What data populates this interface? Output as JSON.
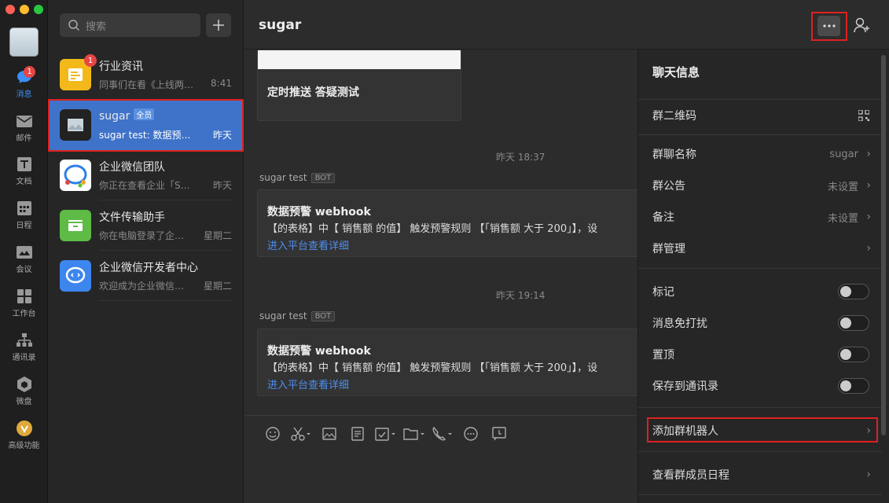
{
  "search": {
    "placeholder": "搜索"
  },
  "rail": {
    "badge": "1",
    "items": [
      "消息",
      "邮件",
      "文档",
      "日程",
      "会议",
      "工作台",
      "通讯录",
      "微盘",
      "高级功能"
    ]
  },
  "conversations": [
    {
      "name": "行业资讯",
      "preview": "同事们在看《上线两…",
      "time": "8:41",
      "badge": "1"
    },
    {
      "name": "sugar",
      "tag": "全员",
      "preview": "sugar test: 数据预警…",
      "time": "昨天"
    },
    {
      "name": "企业微信团队",
      "preview": "你正在查看企业「Su…",
      "time": "昨天"
    },
    {
      "name": "文件传输助手",
      "preview": "你在电脑登录了企…",
      "time": "星期二"
    },
    {
      "name": "企业微信开发者中心",
      "preview": "欢迎成为企业微信…",
      "time": "星期二"
    }
  ],
  "chat": {
    "title": "sugar",
    "first_card_title": "定时推送 答疑测试",
    "messages": [
      {
        "timestamp": "昨天 18:37",
        "sender": "sugar test",
        "bot_tag": "BOT",
        "title": "数据预警 webhook",
        "body": "【的表格】中【 销售额 的值】 触发预警规则 【「销售额 大于 200」】，设",
        "link": "进入平台查看详细"
      },
      {
        "timestamp": "昨天 19:14",
        "sender": "sugar test",
        "bot_tag": "BOT",
        "title": "数据预警 webhook",
        "body": "【的表格】中【 销售额 的值】 触发预警规则 【「销售额 大于 200」】，设",
        "link": "进入平台查看详细"
      }
    ]
  },
  "panel": {
    "title": "聊天信息",
    "qr": "群二维码",
    "group_name": {
      "label": "群聊名称",
      "value": "sugar"
    },
    "announcement": {
      "label": "群公告",
      "value": "未设置"
    },
    "remark": {
      "label": "备注",
      "value": "未设置"
    },
    "manage": "群管理",
    "mark": "标记",
    "mute": "消息免打扰",
    "pin": "置顶",
    "save_contacts": "保存到通讯录",
    "add_robot": "添加群机器人",
    "member_schedule": "查看群成员日程"
  }
}
